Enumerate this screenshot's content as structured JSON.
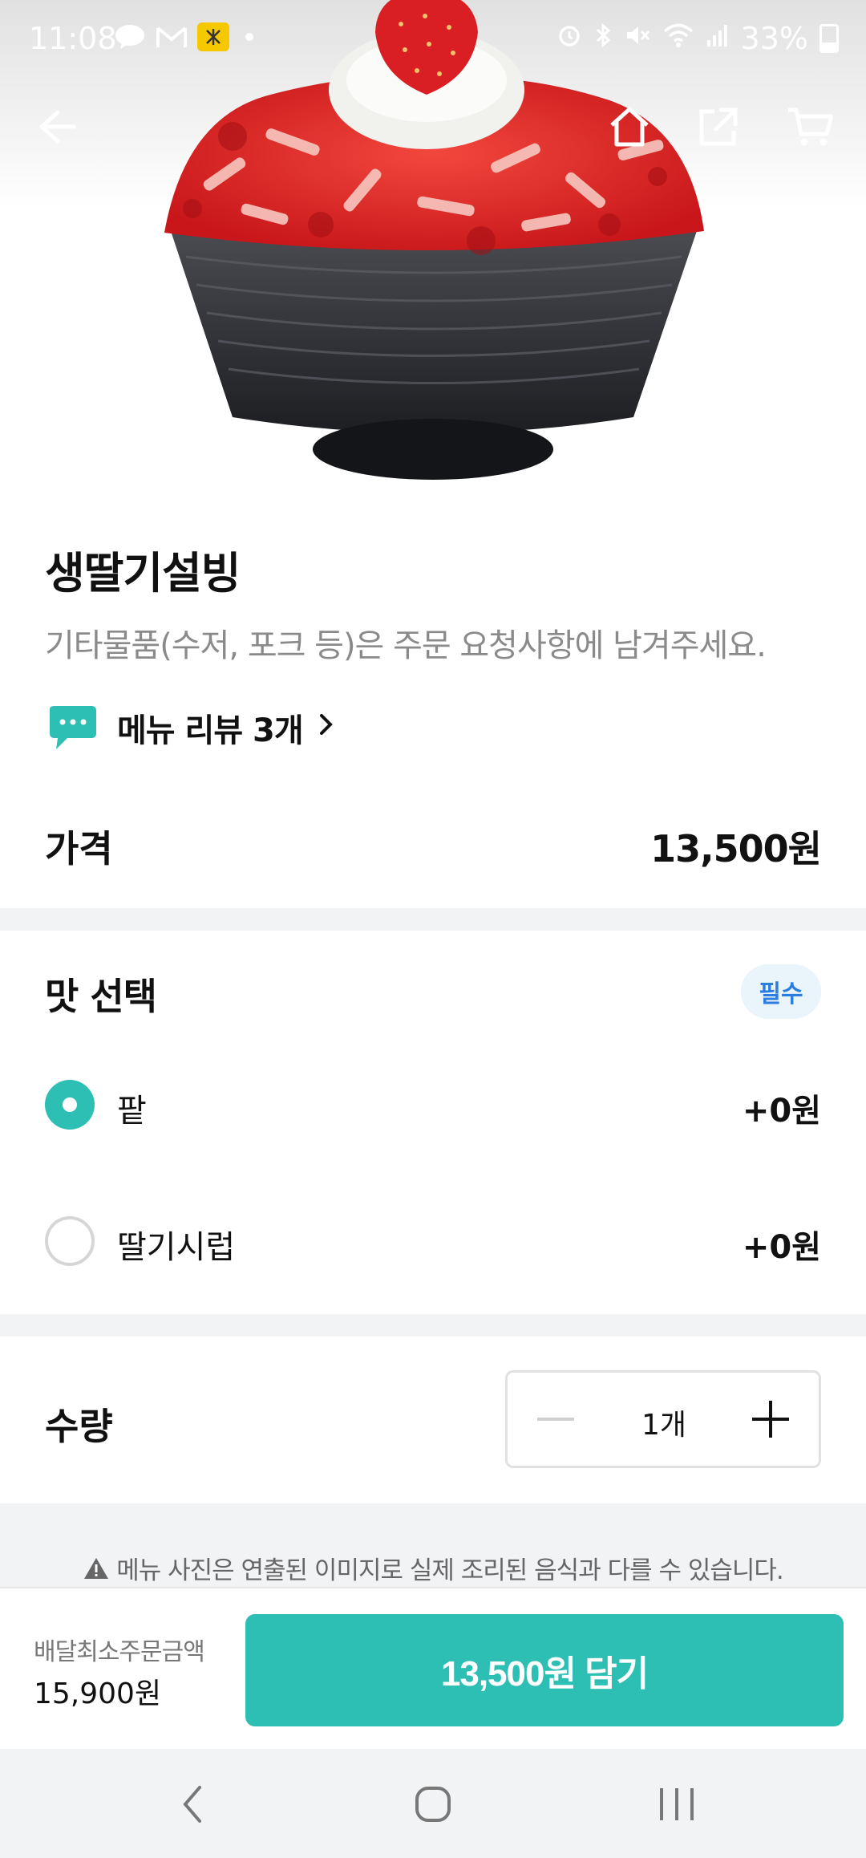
{
  "status_bar": {
    "time": "11:08",
    "battery": "33%",
    "icons_left": [
      "talk-icon",
      "gmail-icon",
      "kb-app-icon"
    ],
    "icons_right": [
      "alarm-icon",
      "bluetooth-icon",
      "mute-icon",
      "wifi-icon",
      "signal-icon",
      "battery-icon"
    ]
  },
  "top_nav": {
    "icons": [
      "back-arrow-icon",
      "home-icon",
      "share-icon",
      "cart-icon"
    ]
  },
  "menu_item": {
    "name": "생딸기설빙",
    "description": "기타물품(수저, 포크 등)은 주문 요청사항에 남겨주세요.",
    "review_link": "메뉴 리뷰 3개",
    "price_label": "가격",
    "price": "13,500원"
  },
  "options": {
    "title": "맛 선택",
    "required_badge": "필수",
    "items": [
      {
        "label": "팥",
        "price": "+0원",
        "selected": true
      },
      {
        "label": "딸기시럽",
        "price": "+0원",
        "selected": false
      }
    ]
  },
  "quantity": {
    "label": "수량",
    "value": "1개"
  },
  "notice": {
    "text": "메뉴 사진은 연출된 이미지로 실제 조리된 음식과 다를 수 있습니다."
  },
  "order_bar": {
    "min_order_label": "배달최소주문금액",
    "min_order_value": "15,900원",
    "add_button_label": "13,500원 담기"
  },
  "colors": {
    "accent": "#2ebfb4",
    "badge_text": "#2b7de0",
    "badge_bg": "#eaf4fb"
  }
}
